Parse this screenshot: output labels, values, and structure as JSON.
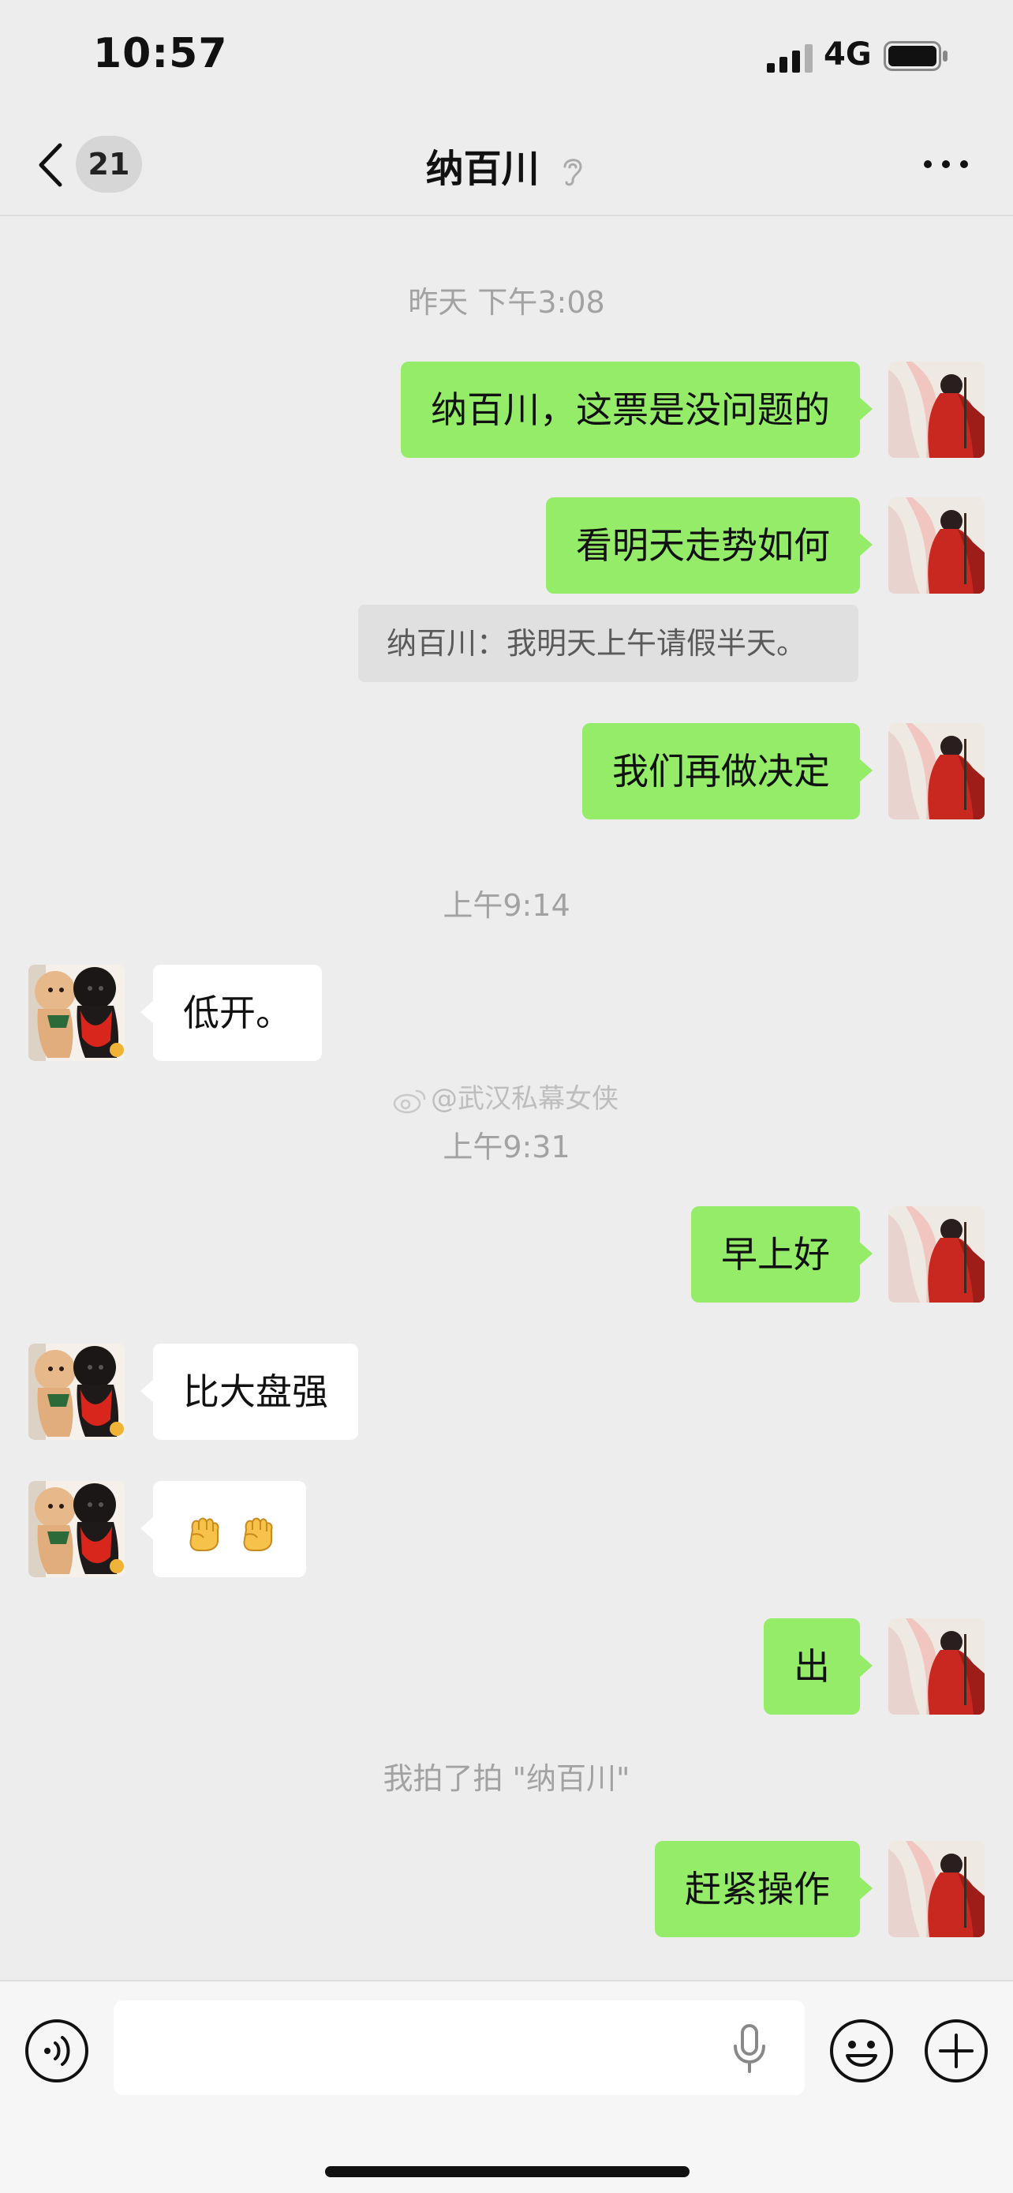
{
  "status_bar": {
    "time": "10:57",
    "network": "4G"
  },
  "nav": {
    "unread_count": "21",
    "title": "纳百川"
  },
  "messages": {
    "ts1": "昨天 下午3:08",
    "m1": "纳百川，这票是没问题的",
    "m2": "看明天走势如何",
    "quote": "纳百川：我明天上午请假半天。",
    "m3": "我们再做决定",
    "ts2": "上午9:14",
    "m4": "低开。",
    "watermark": "@武汉私幕女侠",
    "ts3": "上午9:31",
    "m5": "早上好",
    "m6": "比大盘强",
    "m7_icons": [
      "raised-fist-emoji",
      "raised-fist-emoji"
    ],
    "m8": "出",
    "system_pat": "我拍了拍 \"纳百川\"",
    "m9": "赶紧操作"
  },
  "colors": {
    "background": "#ededed",
    "outgoing_bubble": "#95ec69",
    "incoming_bubble": "#ffffff",
    "timestamp_text": "#a2a2a2"
  },
  "icons": {
    "nav": [
      "back-chevron-icon",
      "mute-ear-icon",
      "more-icon"
    ],
    "input": [
      "voice-icon",
      "microphone-icon",
      "emoji-icon",
      "plus-icon"
    ]
  }
}
